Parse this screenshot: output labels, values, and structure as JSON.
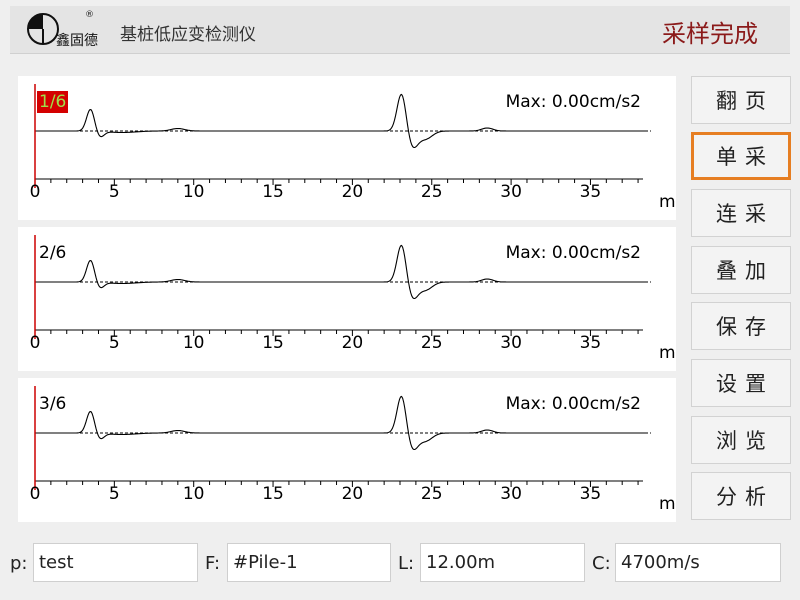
{
  "header": {
    "brand": "鑫固德",
    "registered_mark": "®",
    "app_title": "基桩低应变检测仪",
    "status": "采样完成"
  },
  "panels": [
    {
      "label": "1/6",
      "max": "Max: 0.00cm/s2",
      "active": true
    },
    {
      "label": "2/6",
      "max": "Max: 0.00cm/s2",
      "active": false
    },
    {
      "label": "3/6",
      "max": "Max: 0.00cm/s2",
      "active": false
    }
  ],
  "axis": {
    "ticks": [
      "0",
      "5",
      "10",
      "15",
      "20",
      "25",
      "30",
      "35"
    ],
    "unit": "m"
  },
  "buttons": [
    {
      "label": "翻页"
    },
    {
      "label": "单采",
      "selected": true
    },
    {
      "label": "连采"
    },
    {
      "label": "叠加"
    },
    {
      "label": "保存"
    },
    {
      "label": "设置"
    },
    {
      "label": "浏览"
    },
    {
      "label": "分析"
    }
  ],
  "fields": {
    "p": {
      "label": "p:",
      "value": "test"
    },
    "f": {
      "label": "F:",
      "value": "#Pile-1"
    },
    "l": {
      "label": "L:",
      "value": "12.00m"
    },
    "c": {
      "label": "C:",
      "value": "4700m/s"
    }
  },
  "colors": {
    "status": "#8b1a1a",
    "marker": "#cc0000",
    "selected_border": "#e67e22"
  }
}
